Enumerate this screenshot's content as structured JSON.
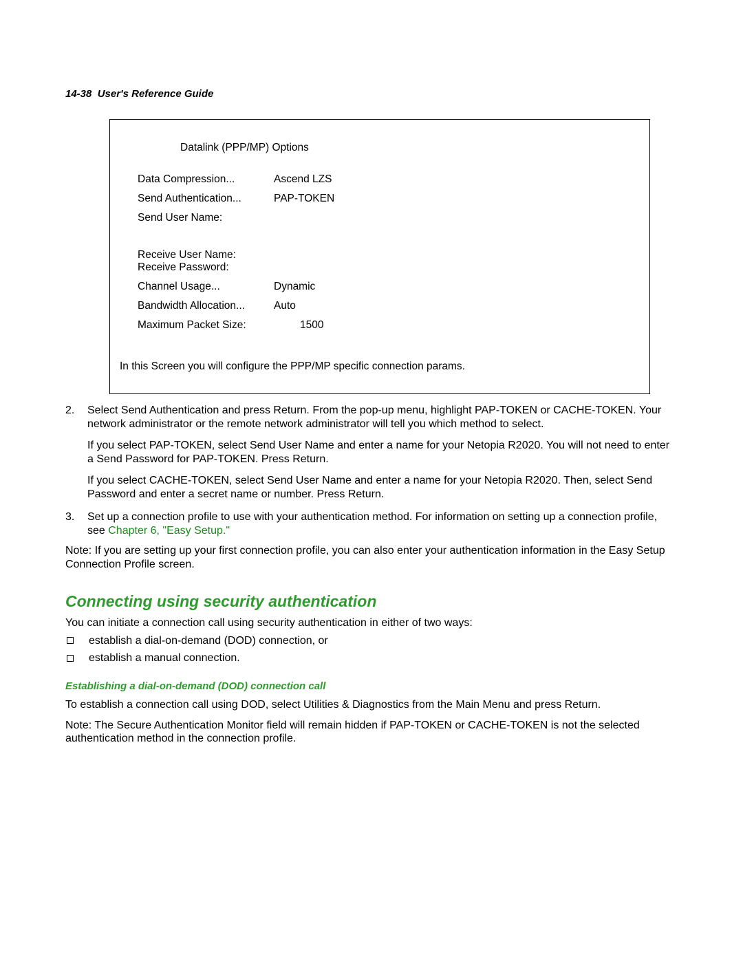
{
  "header": {
    "page_ref": "14-38  User's Reference Guide"
  },
  "screen": {
    "title": "Datalink (PPP/MP) Options",
    "rows": [
      {
        "label": "Data Compression...",
        "value": "Ascend LZS"
      },
      {
        "label": "Send Authentication...",
        "value": "PAP-TOKEN"
      },
      {
        "label": "Send User Name:",
        "value": ""
      }
    ],
    "rows2": [
      {
        "label": "Receive User Name:",
        "value": ""
      },
      {
        "label": "Receive Password:",
        "value": ""
      },
      {
        "label": "Channel Usage...",
        "value": "Dynamic"
      },
      {
        "label": "Bandwidth Allocation...",
        "value": "Auto"
      },
      {
        "label": "Maximum Packet Size:",
        "value": "1500"
      }
    ],
    "footer": "In this Screen you will configure the PPP/MP specific connection params."
  },
  "steps": [
    {
      "num": "2.",
      "paras": [
        "Select Send Authentication and press Return. From the pop-up menu, highlight PAP-TOKEN or CACHE-TOKEN. Your network administrator or the remote network administrator will tell you which method to select.",
        "If you select PAP-TOKEN, select Send User Name and enter a name for your Netopia R2020. You will not need to enter a Send Password for PAP-TOKEN. Press Return.",
        "If you select CACHE-TOKEN, select Send User Name and enter a name for your Netopia R2020. Then, select Send Password and enter a secret name or number. Press Return."
      ]
    },
    {
      "num": "3.",
      "paras_pre_link": "Set up a connection profile to use with your authentication method. For information on setting up a connection profile, see ",
      "link_text": "Chapter 6, \"Easy Setup.\""
    }
  ],
  "note1": "Note:  If you are setting up your first connection profile, you can also enter your authentication information in the Easy Setup Connection Profile screen.",
  "section_heading": "Connecting using security authentication",
  "section_intro": "You can initiate a connection call using security authentication in either of two ways:",
  "bullets": [
    "establish a dial-on-demand (DOD) connection, or",
    "establish a manual connection."
  ],
  "sub_heading": "Establishing a dial-on-demand (DOD) connection call",
  "dod_para": "To establish a connection call using DOD, select Utilities & Diagnostics from the Main Menu and press Return.",
  "note2": "Note:  The Secure Authentication Monitor field will remain hidden if PAP-TOKEN or CACHE-TOKEN is not the selected authentication method in the connection profile."
}
